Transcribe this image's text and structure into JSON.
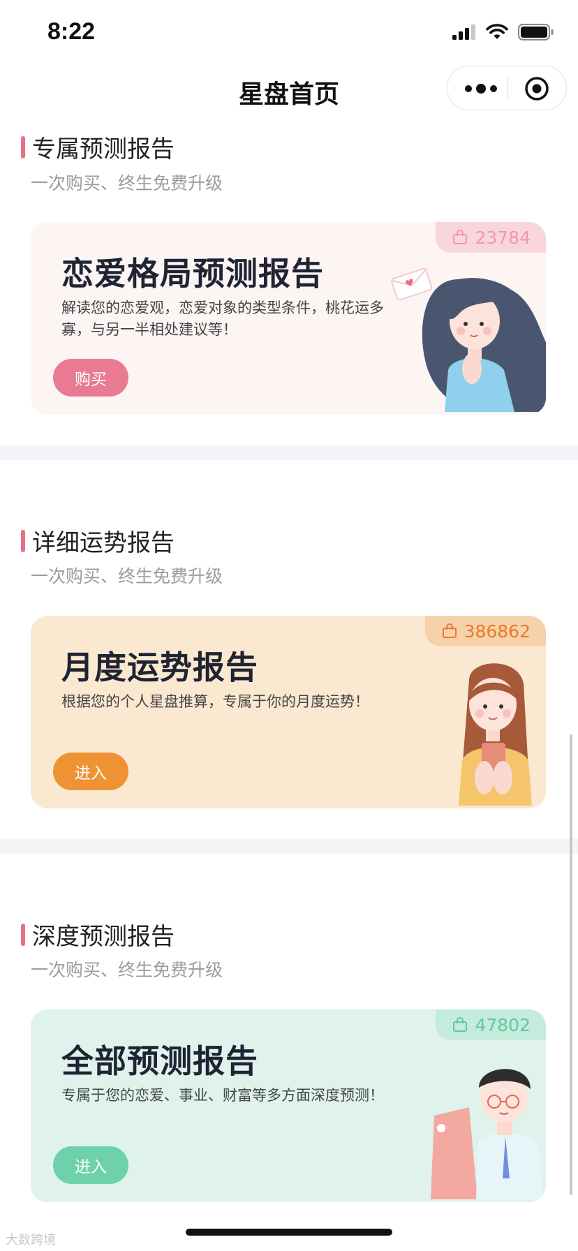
{
  "status": {
    "time": "8:22"
  },
  "nav": {
    "title": "星盘首页"
  },
  "sections": [
    {
      "title": "专属预测报告",
      "subtitle": "一次购买、终生免费升级",
      "card": {
        "title": "恋爱格局预测报告",
        "description": "解读您的恋爱观，恋爱对象的类型条件，桃花运多寡，与另一半相处建议等！",
        "button": "购买",
        "count": "23784",
        "bg": "#fdf4f4",
        "accent": "#e87b92",
        "badge_bg": "#f9d5dc"
      }
    },
    {
      "title": "详细运势报告",
      "subtitle": "一次购买、终生免费升级",
      "card": {
        "title": "月度运势报告",
        "description": "根据您的个人星盘推算，专属于你的月度运势！",
        "button": "进入",
        "count": "386862",
        "bg": "#fbe8d0",
        "accent": "#ef9234",
        "badge_bg": "#f6d2aa"
      }
    },
    {
      "title": "深度预测报告",
      "subtitle": "一次购买、终生免费升级",
      "card": {
        "title": "全部预测报告",
        "description": "专属于您的恋爱、事业、财富等多方面深度预测！",
        "button": "进入",
        "count": "47802",
        "bg": "#dff3ec",
        "accent": "#6fd0ac",
        "badge_bg": "#c5ebdc"
      }
    }
  ],
  "watermark": "大数跨境"
}
